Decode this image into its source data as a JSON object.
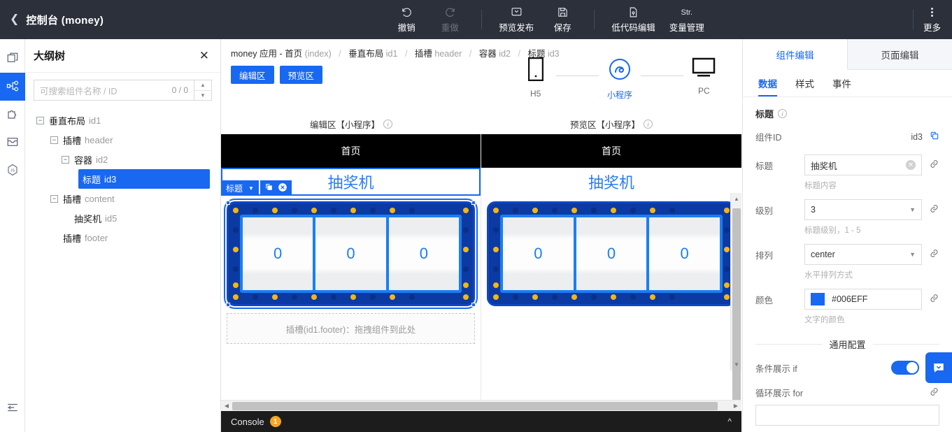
{
  "topbar": {
    "back_icon": "chevron-left-icon",
    "title": "控制台 (money)",
    "actions": [
      {
        "label": "撤销",
        "icon": "undo-icon"
      },
      {
        "label": "重做",
        "icon": "redo-icon"
      },
      {
        "label": "预览发布",
        "icon": "publish-icon"
      },
      {
        "label": "保存",
        "icon": "save-icon"
      },
      {
        "label": "低代码编辑",
        "icon": "code-file-icon"
      },
      {
        "label": "变量管理",
        "icon": "str-icon",
        "icon_text": "Str."
      }
    ],
    "more_label": "更多"
  },
  "rail": {
    "items": [
      {
        "name": "pages-icon"
      },
      {
        "name": "component-tree-icon"
      },
      {
        "name": "puzzle-icon"
      },
      {
        "name": "inbox-icon"
      },
      {
        "name": "js-icon"
      }
    ],
    "collapse_icon": "collapse-panel-icon"
  },
  "outline": {
    "title": "大纲树",
    "close_icon": "close-icon",
    "search_placeholder": "可搜索组件名称 / ID",
    "search_value": "",
    "match_count": "0 / 0",
    "up_icon": "chevron-up-icon",
    "down_icon": "chevron-down-icon",
    "nodes": [
      {
        "indent": 0,
        "toggle": "minus",
        "name": "垂直布局",
        "id": "id1",
        "selected": false
      },
      {
        "indent": 1,
        "toggle": "minus",
        "name": "插槽",
        "id": "header",
        "selected": false
      },
      {
        "indent": 2,
        "toggle": "minus",
        "name": "容器",
        "id": "id2",
        "selected": false
      },
      {
        "indent": 3,
        "toggle": "leaf",
        "name": "标题",
        "id": "id3",
        "selected": true
      },
      {
        "indent": 1,
        "toggle": "minus",
        "name": "插槽",
        "id": "content",
        "selected": false
      },
      {
        "indent": 2,
        "toggle": "leaf",
        "name": "抽奖机",
        "id": "id5",
        "selected": false
      },
      {
        "indent": 1,
        "toggle": "none",
        "name": "插槽",
        "id": "footer",
        "selected": false
      }
    ]
  },
  "breadcrumb": {
    "items": [
      {
        "name": "money 应用 - 首页",
        "id": "(index)"
      },
      {
        "name": "垂直布局",
        "id": "id1"
      },
      {
        "name": "插槽",
        "id": "header"
      },
      {
        "name": "容器",
        "id": "id2"
      },
      {
        "name": "标题",
        "id": "id3"
      }
    ],
    "separator": "/"
  },
  "segmented": {
    "edit_label": "编辑区",
    "preview_label": "预览区"
  },
  "devices": [
    {
      "label": "H5",
      "icon": "phone-icon",
      "active": false
    },
    {
      "label": "小程序",
      "icon": "miniprogram-icon",
      "active": true
    },
    {
      "label": "PC",
      "icon": "monitor-icon",
      "active": false
    }
  ],
  "zones": {
    "edit_label": "编辑区【小程序】",
    "preview_label": "预览区【小程序】",
    "info_icon": "info-icon"
  },
  "canvas": {
    "status_title": "首页",
    "heading_text": "抽奖机",
    "heading_color": "#006EFF",
    "selection_tag": "标题",
    "selection_caret_icon": "chevron-down-icon",
    "copy_icon": "copy-icon",
    "delete_icon": "close-circle-icon",
    "reels": [
      "0",
      "0",
      "0"
    ],
    "slot_placeholder": "插槽(id1.footer)：拖拽组件到此处"
  },
  "console": {
    "label": "Console",
    "badge": "1",
    "chevron_icon": "chevron-up-icon"
  },
  "props": {
    "tabs": [
      {
        "label": "组件编辑",
        "active": true
      },
      {
        "label": "页面编辑",
        "active": false
      }
    ],
    "subtabs": [
      {
        "label": "数据",
        "active": true
      },
      {
        "label": "样式",
        "active": false
      },
      {
        "label": "事件",
        "active": false
      }
    ],
    "section_title": "标题",
    "info_icon": "info-icon",
    "component_id_label": "组件ID",
    "component_id_value": "id3",
    "copy_icon": "copy-icon",
    "fields": [
      {
        "label": "标题",
        "type": "text",
        "value": "抽奖机",
        "hint": "标题内容",
        "clear_icon": "clear-icon",
        "link_icon": "link-icon"
      },
      {
        "label": "级别",
        "type": "select",
        "value": "3",
        "hint": "标题级别，1 - 5",
        "caret_icon": "chevron-down-icon",
        "link_icon": "link-icon"
      },
      {
        "label": "排列",
        "type": "select",
        "value": "center",
        "hint": "水平排列方式",
        "caret_icon": "chevron-down-icon",
        "link_icon": "link-icon"
      },
      {
        "label": "颜色",
        "type": "color",
        "value": "#006EFF",
        "hint": "文字的颜色",
        "swatch": "#1868f1",
        "link_icon": "link-icon"
      }
    ],
    "common_section_title": "通用配置",
    "common_fields": [
      {
        "label": "条件展示 if",
        "type": "toggle",
        "value": true,
        "link_icon": "link-icon"
      },
      {
        "label": "循环展示 for",
        "type": "text",
        "value": "",
        "link_icon": "link-icon"
      }
    ],
    "fab_icon": "chat-icon"
  },
  "colors": {
    "accent": "#1868f1",
    "topbar_bg": "#2b303b",
    "heading": "#006EFF",
    "badge": "#f5a623"
  }
}
